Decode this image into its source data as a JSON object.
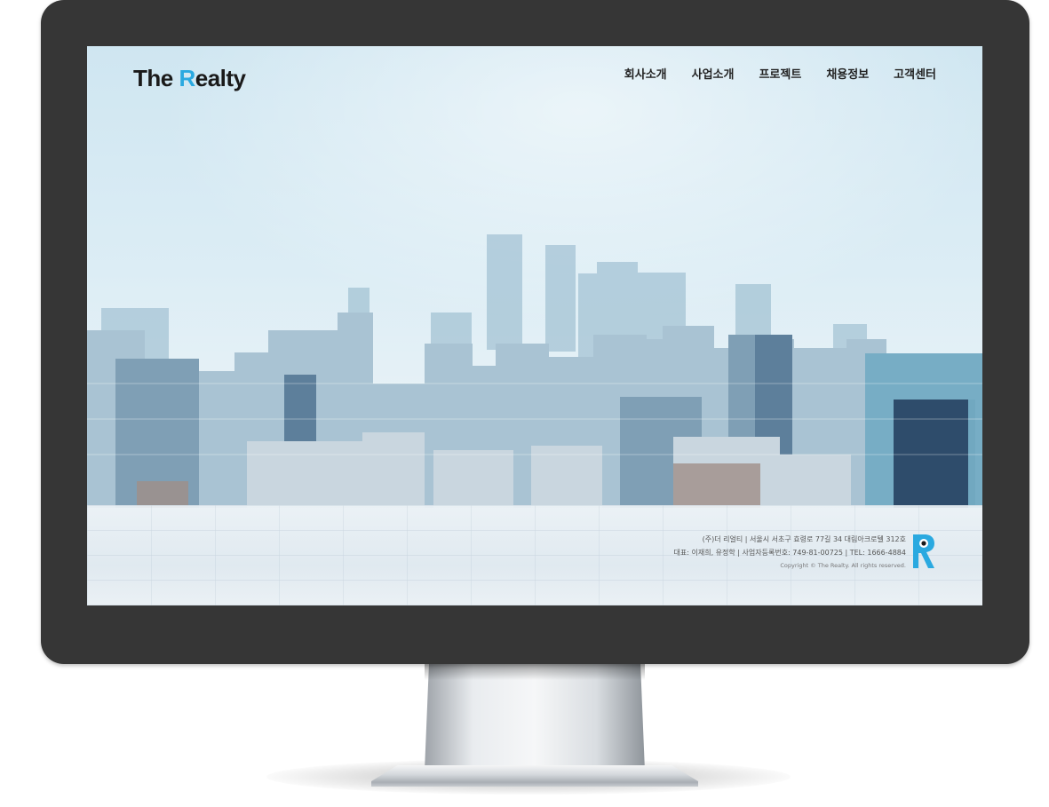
{
  "site": {
    "logo_prefix": "The ",
    "logo_accent": "R",
    "logo_suffix": "ealty"
  },
  "nav": {
    "items": [
      {
        "label": "회사소개"
      },
      {
        "label": "사업소개"
      },
      {
        "label": "프로젝트"
      },
      {
        "label": "채용정보"
      },
      {
        "label": "고객센터"
      }
    ]
  },
  "footer": {
    "address_line": "(주)더 리얼티 | 서울시 서초구 효령로 77길 34 대림아크로텔 312호",
    "info_line": "대표: 이재희, 유정학 | 사업자등록번호: 749-81-00725 | TEL: 1666-4884",
    "copyright": "Copyright © The Realty. All rights reserved."
  },
  "colors": {
    "accent": "#2aa9e0",
    "bezel": "#363636",
    "text_dark": "#222222"
  },
  "icons": {
    "brand_mark": "realty-r-logo-icon"
  }
}
